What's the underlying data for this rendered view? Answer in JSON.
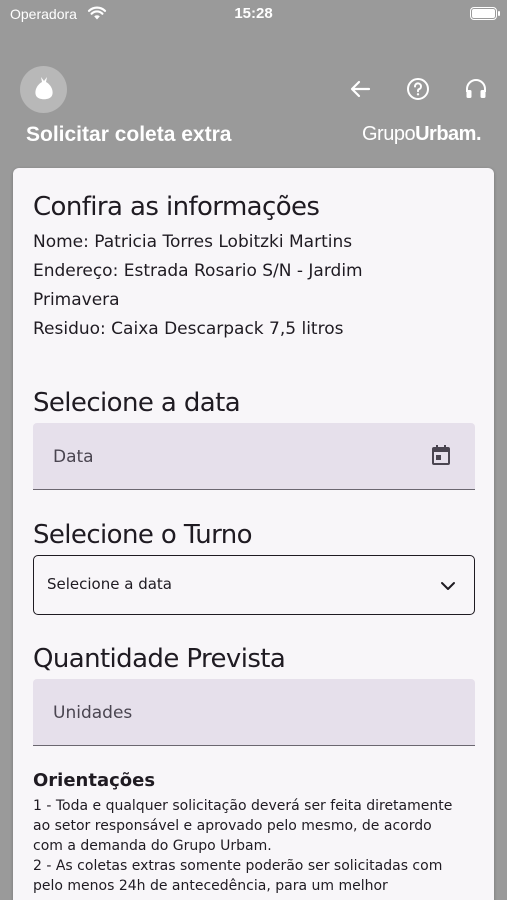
{
  "status_bar": {
    "carrier": "Operadora",
    "time": "15:28"
  },
  "header": {
    "title": "Solicitar coleta extra",
    "brand_part1": "Grupo",
    "brand_part2": "Urbam."
  },
  "colors": {
    "header_bg": "#9a9a9a",
    "card_bg": "#f8f6f9",
    "field_fill": "#e6e0eb",
    "text": "#1f1b22"
  },
  "info": {
    "heading": "Confira as informações",
    "name": "Nome: Patricia Torres Lobitzki Martins",
    "address_line1": "Endereço: Estrada Rosario S/N - Jardim",
    "address_line2": "Primavera",
    "residue": "Residuo: Caixa Descarpack 7,5 litros"
  },
  "date_section": {
    "heading": "Selecione a data",
    "placeholder": "Data",
    "icon": "calendar-icon"
  },
  "shift_section": {
    "heading": "Selecione o Turno",
    "selected": "Selecione a data",
    "icon": "chevron-down-icon"
  },
  "quantity_section": {
    "heading": "Quantidade Prevista",
    "placeholder": "Unidades"
  },
  "guidelines": {
    "title": "Orientações",
    "item1_lines": [
      "1 - Toda e qualquer solicitação deverá ser feita diretamente",
      "ao setor responsável e aprovado pelo mesmo, de acordo",
      "com a demanda do Grupo Urbam."
    ],
    "item2_lines": [
      "2 - As coletas extras somente poderão ser solicitadas com",
      "pelo menos 24h de antecedência, para um melhor"
    ]
  }
}
